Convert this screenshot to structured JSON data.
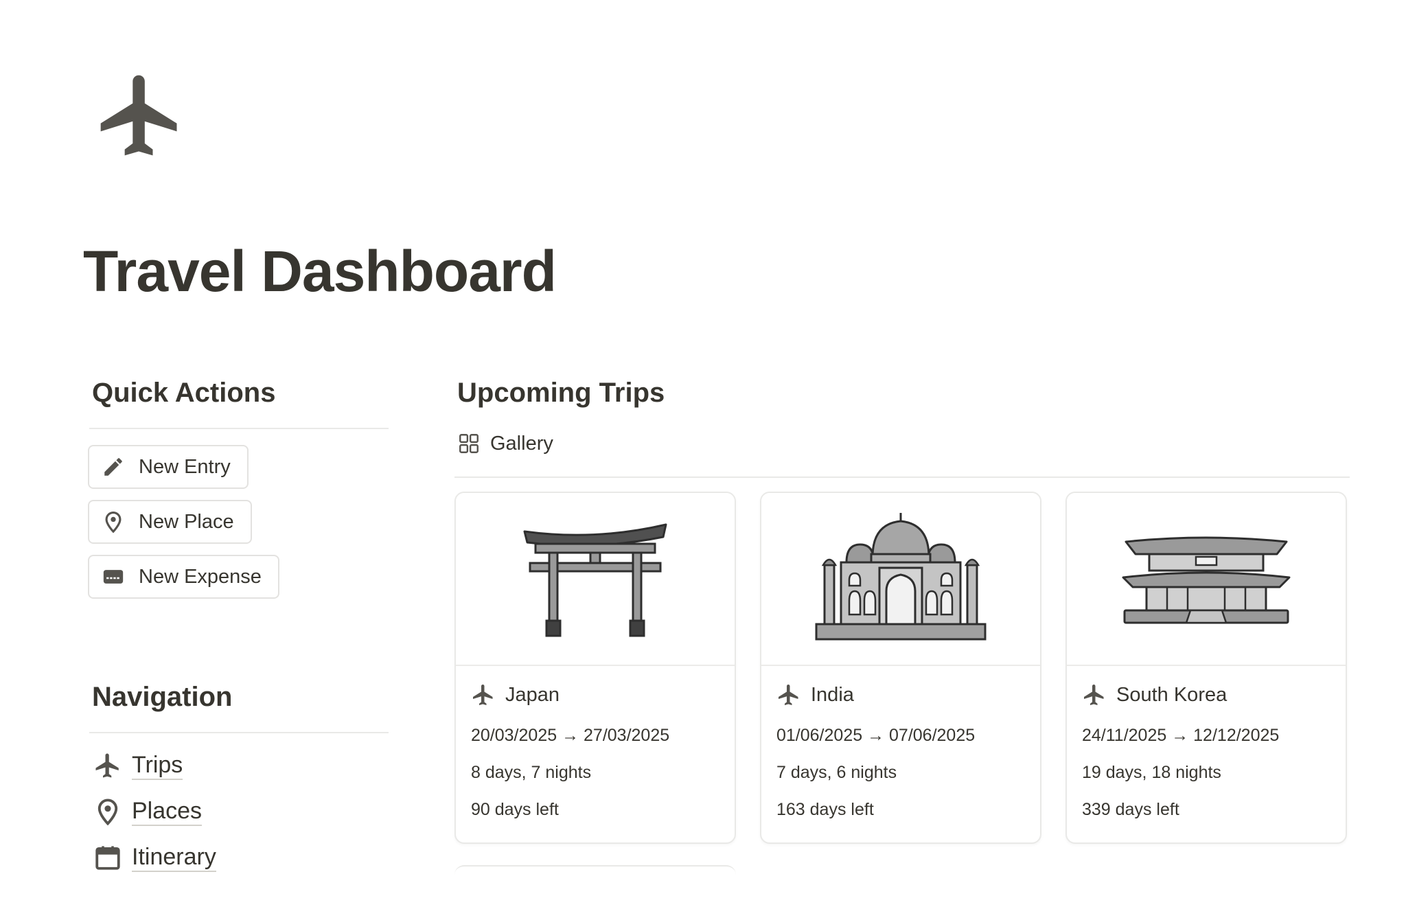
{
  "page": {
    "icon": "airplane-icon",
    "title": "Travel Dashboard"
  },
  "quick_actions": {
    "heading": "Quick Actions",
    "buttons": [
      {
        "label": "New Entry",
        "icon": "pencil-icon"
      },
      {
        "label": "New Place",
        "icon": "map-pin-icon"
      },
      {
        "label": "New Expense",
        "icon": "credit-card-icon"
      }
    ]
  },
  "navigation": {
    "heading": "Navigation",
    "items": [
      {
        "label": "Trips",
        "icon": "airplane-icon"
      },
      {
        "label": "Places",
        "icon": "map-pin-icon"
      },
      {
        "label": "Itinerary",
        "icon": "calendar-icon"
      }
    ]
  },
  "upcoming_trips": {
    "heading": "Upcoming Trips",
    "view_tab": {
      "label": "Gallery",
      "icon": "gallery-grid-icon"
    },
    "cards": [
      {
        "country": "Japan",
        "cover": "torii-gate-illustration",
        "dates": "20/03/2025 → 27/03/2025",
        "duration": "8 days, 7 nights",
        "countdown": "90 days left"
      },
      {
        "country": "India",
        "cover": "taj-mahal-illustration",
        "dates": "01/06/2025 → 07/06/2025",
        "duration": "7 days, 6 nights",
        "countdown": "163 days left"
      },
      {
        "country": "South Korea",
        "cover": "korean-palace-illustration",
        "dates": "24/11/2025 → 12/12/2025",
        "duration": "19 days, 18 nights",
        "countdown": "339 days left"
      }
    ]
  },
  "colors": {
    "text": "#37352f",
    "icon": "#55534e",
    "border": "#e9e9e7"
  }
}
